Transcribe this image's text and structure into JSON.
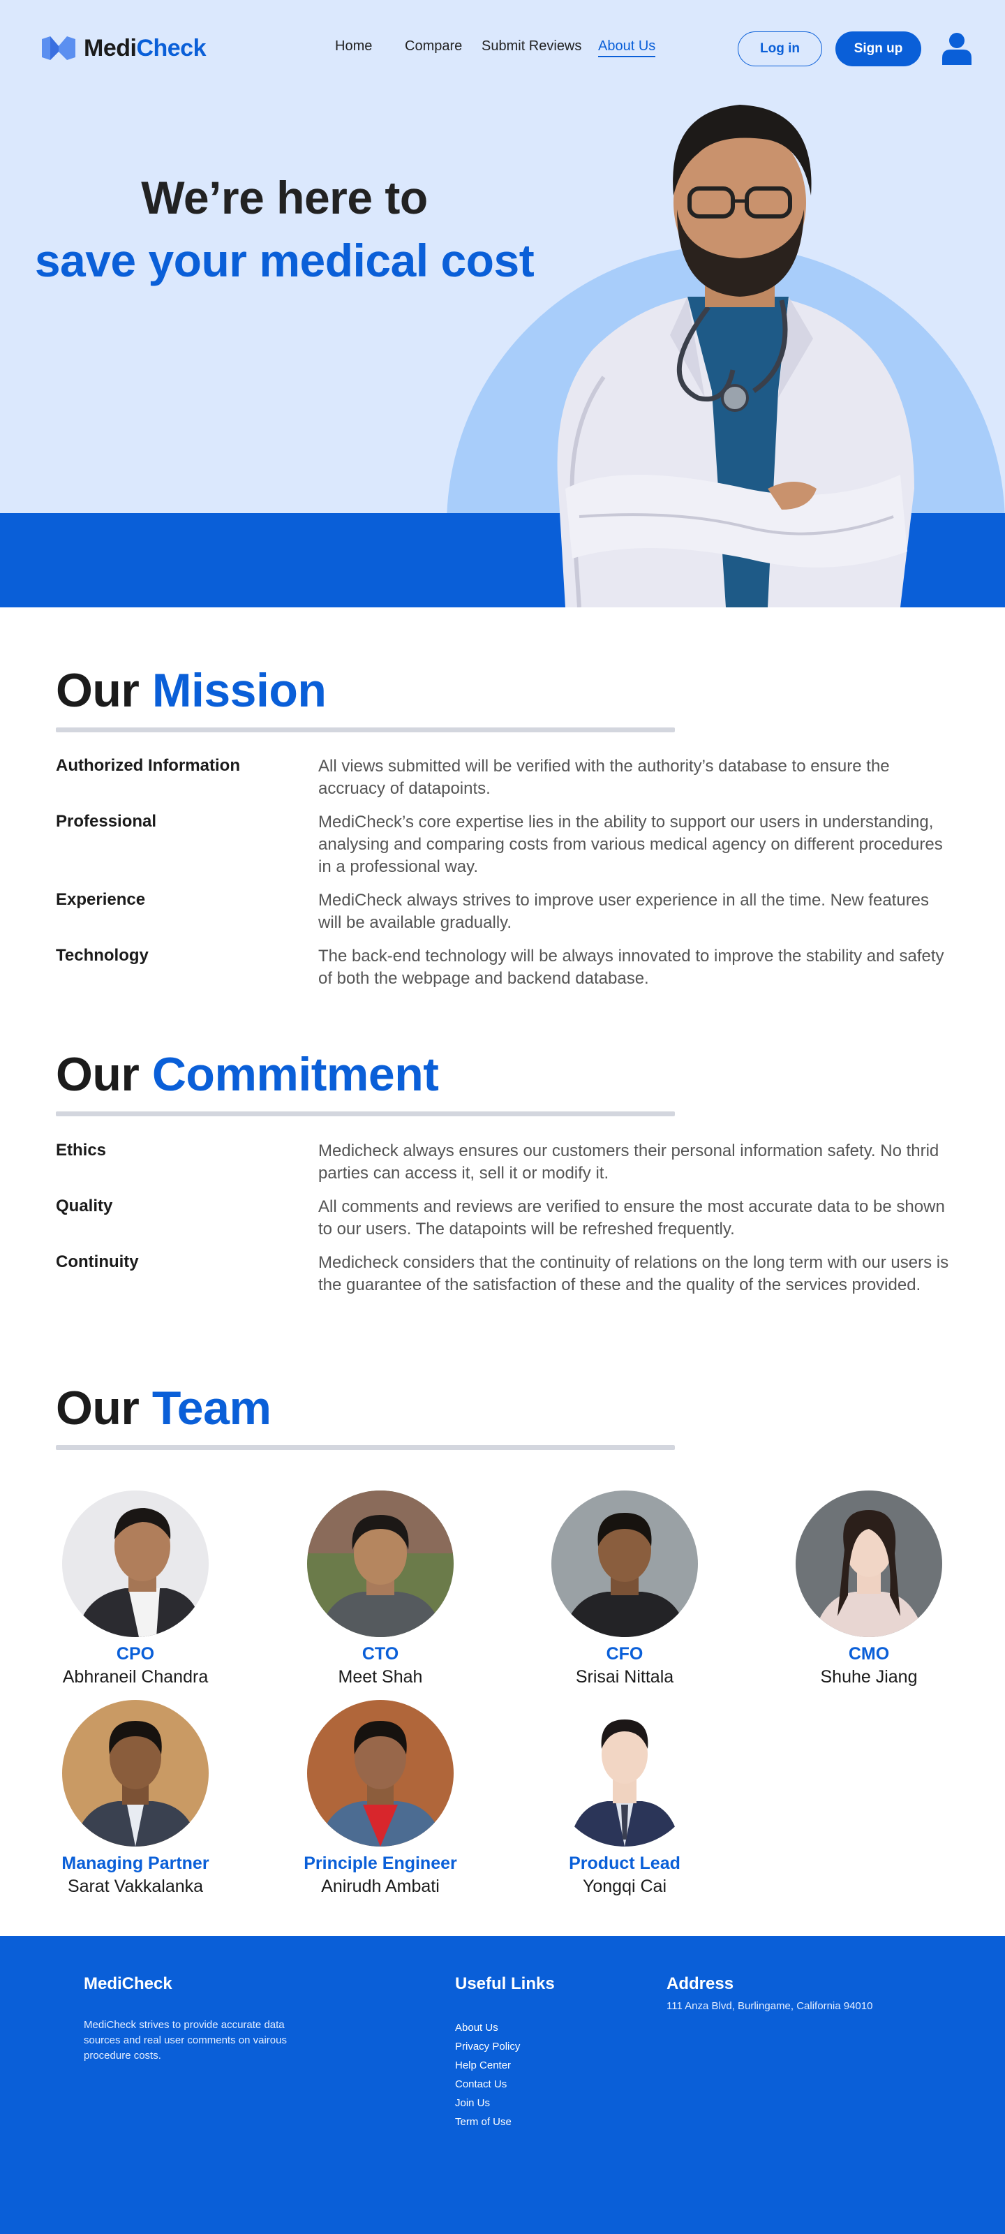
{
  "brand": {
    "name_part1": "Medi",
    "name_part2": "Check",
    "accent": "#0a5fd8",
    "hero_bg": "#dbe8fd",
    "circle": "#a8cdfa"
  },
  "nav": {
    "links": [
      "Home",
      "Compare",
      "Submit Reviews",
      "About Us"
    ],
    "active": "About Us",
    "login_label": "Log in",
    "signup_label": "Sign up",
    "user_icon": "user-icon"
  },
  "hero": {
    "line1": "We’re here to",
    "line2": "save your medical cost"
  },
  "mission": {
    "title_part1": "Our",
    "title_part2": "Mission",
    "rows": [
      {
        "label": "Authorized Information",
        "text": "All views submitted will be verified with the authority’s database to ensure the accruacy of datapoints."
      },
      {
        "label": "Professional",
        "text": "MediCheck’s core expertise lies in the ability to support our users in understanding, analysing and comparing costs from various medical agency on different procedures in a professional way."
      },
      {
        "label": "Experience",
        "text": "MediCheck always strives to improve user experience in all the time. New features will be available gradually."
      },
      {
        "label": "Technology",
        "text": "The back-end technology will be always innovated to improve the stability and safety of both the webpage and backend database."
      }
    ]
  },
  "commitment": {
    "title_part1": "Our",
    "title_part2": "Commitment",
    "rows": [
      {
        "label": "Ethics",
        "text": "Medicheck always ensures our customers their personal information safety. No thrid parties can access it, sell it or modify it."
      },
      {
        "label": "Quality",
        "text": "All comments and reviews are verified to ensure the most accurate data to be shown to our users. The datapoints will be refreshed frequently."
      },
      {
        "label": "Continuity",
        "text": "Medicheck considers that the continuity of relations on the long term with our users is the guarantee of the satisfaction of these and the quality of the services provided."
      }
    ]
  },
  "team": {
    "title_part1": "Our",
    "title_part2": "Team",
    "members": [
      {
        "role": "CPO",
        "name": "Abhraneil Chandra"
      },
      {
        "role": "CTO",
        "name": "Meet Shah"
      },
      {
        "role": "CFO",
        "name": "Srisai Nittala"
      },
      {
        "role": "CMO",
        "name": "Shuhe Jiang"
      },
      {
        "role": "Managing Partner",
        "name": "Sarat Vakkalanka"
      },
      {
        "role": "Principle Engineer",
        "name": "Anirudh Ambati"
      },
      {
        "role": "Product Lead",
        "name": "Yongqi Cai"
      }
    ]
  },
  "footer": {
    "brand": "MediCheck",
    "description": "MediCheck strives to provide accurate data sources and real user comments on vairous procedure costs.",
    "links_title": "Useful Links",
    "links": [
      "About Us",
      "Privacy Policy",
      "Help Center",
      "Contact Us",
      "Join Us",
      "Term of Use"
    ],
    "address_title": "Address",
    "address": "111 Anza Blvd, Burlingame, California 94010"
  }
}
